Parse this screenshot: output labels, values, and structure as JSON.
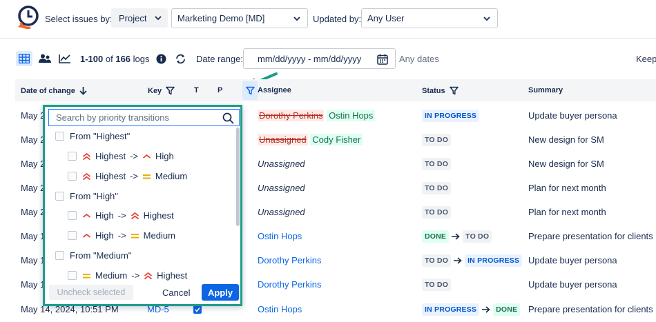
{
  "toolbar": {
    "select_label": "Select issues by:",
    "project_button": "Project",
    "project_value": "Marketing Demo [MD]",
    "updated_label": "Updated by:",
    "user_value": "Any User"
  },
  "controls": {
    "range_start": "1-100",
    "range_of": "of",
    "total": "166",
    "range_unit": "logs",
    "date_label": "Date range:",
    "date_placeholder": "mm/dd/yyyy - mm/dd/yyyy",
    "any_dates": "Any dates",
    "keep": "Keep"
  },
  "table": {
    "headers": [
      "Date of change",
      "Key",
      "T",
      "P",
      "Assignee",
      "Status",
      "Summary"
    ],
    "rows": [
      {
        "date": "May 2",
        "assignee_old": "Dorothy Perkins",
        "assignee_new": "Ostin Hops",
        "status": [
          {
            "label": "IN PROGRESS",
            "kind": "prog"
          }
        ],
        "summary": "Update buyer persona"
      },
      {
        "date": "May 2",
        "assignee_old": "Unassigned",
        "assignee_new": "Cody Fisher",
        "status": [
          {
            "label": "TO DO",
            "kind": "todo"
          }
        ],
        "summary": "New design for SM"
      },
      {
        "date": "May 2",
        "assignee": "Unassigned",
        "assignee_style": "italic",
        "status": [
          {
            "label": "TO DO",
            "kind": "todo"
          }
        ],
        "summary": "New design for SM"
      },
      {
        "date": "May 2",
        "assignee": "Unassigned",
        "assignee_style": "italic",
        "status": [
          {
            "label": "TO DO",
            "kind": "todo"
          }
        ],
        "summary": "Plan for next month"
      },
      {
        "date": "May 2",
        "assignee": "Unassigned",
        "assignee_style": "italic",
        "status": [
          {
            "label": "TO DO",
            "kind": "todo"
          }
        ],
        "summary": "Plan for next month"
      },
      {
        "date": "May 1",
        "assignee": "Ostin Hops",
        "assignee_style": "link",
        "status": [
          {
            "label": "DONE",
            "kind": "done"
          },
          {
            "label": "TO DO",
            "kind": "todo"
          }
        ],
        "summary": "Prepare presentation for clients"
      },
      {
        "date": "May 1",
        "assignee": "Dorothy Perkins",
        "assignee_style": "link",
        "status": [
          {
            "label": "TO DO",
            "kind": "todo"
          },
          {
            "label": "IN PROGRESS",
            "kind": "prog"
          }
        ],
        "summary": "Update buyer persona"
      },
      {
        "date": "May 1",
        "assignee": "Dorothy Perkins",
        "assignee_style": "link",
        "status": [
          {
            "label": "TO DO",
            "kind": "todo"
          }
        ],
        "summary": "Update buyer persona"
      },
      {
        "date": "May 14, 2024, 10:51 PM",
        "key": "MD-5",
        "assignee": "Ostin Hops",
        "assignee_style": "link",
        "status": [
          {
            "label": "IN PROGRESS",
            "kind": "prog"
          },
          {
            "label": "DONE",
            "kind": "done"
          }
        ],
        "summary": "Prepare presentation for clients"
      }
    ]
  },
  "popover": {
    "search_placeholder": "Search by priority transitions",
    "groups": [
      {
        "label": "From \"Highest\"",
        "items": [
          {
            "from": "Highest",
            "from_icon": "highest",
            "arrow": "->",
            "to": "High",
            "to_icon": "high"
          },
          {
            "from": "Highest",
            "from_icon": "highest",
            "arrow": "->",
            "to": "Medium",
            "to_icon": "medium"
          }
        ]
      },
      {
        "label": "From \"High\"",
        "items": [
          {
            "from": "High",
            "from_icon": "high",
            "arrow": "->",
            "to": "Highest",
            "to_icon": "highest"
          },
          {
            "from": "High",
            "from_icon": "high",
            "arrow": "->",
            "to": "Medium",
            "to_icon": "medium"
          }
        ]
      },
      {
        "label": "From \"Medium\"",
        "items": [
          {
            "from": "Medium",
            "from_icon": "medium",
            "arrow": "->",
            "to": "Highest",
            "to_icon": "highest"
          }
        ]
      }
    ],
    "uncheck_label": "Uncheck selected",
    "cancel_label": "Cancel",
    "apply_label": "Apply"
  },
  "colors": {
    "accent": "#0c66e4",
    "popover_border": "#1f9c8b",
    "priority_high": "#e2483d",
    "priority_medium": "#e2b203"
  }
}
